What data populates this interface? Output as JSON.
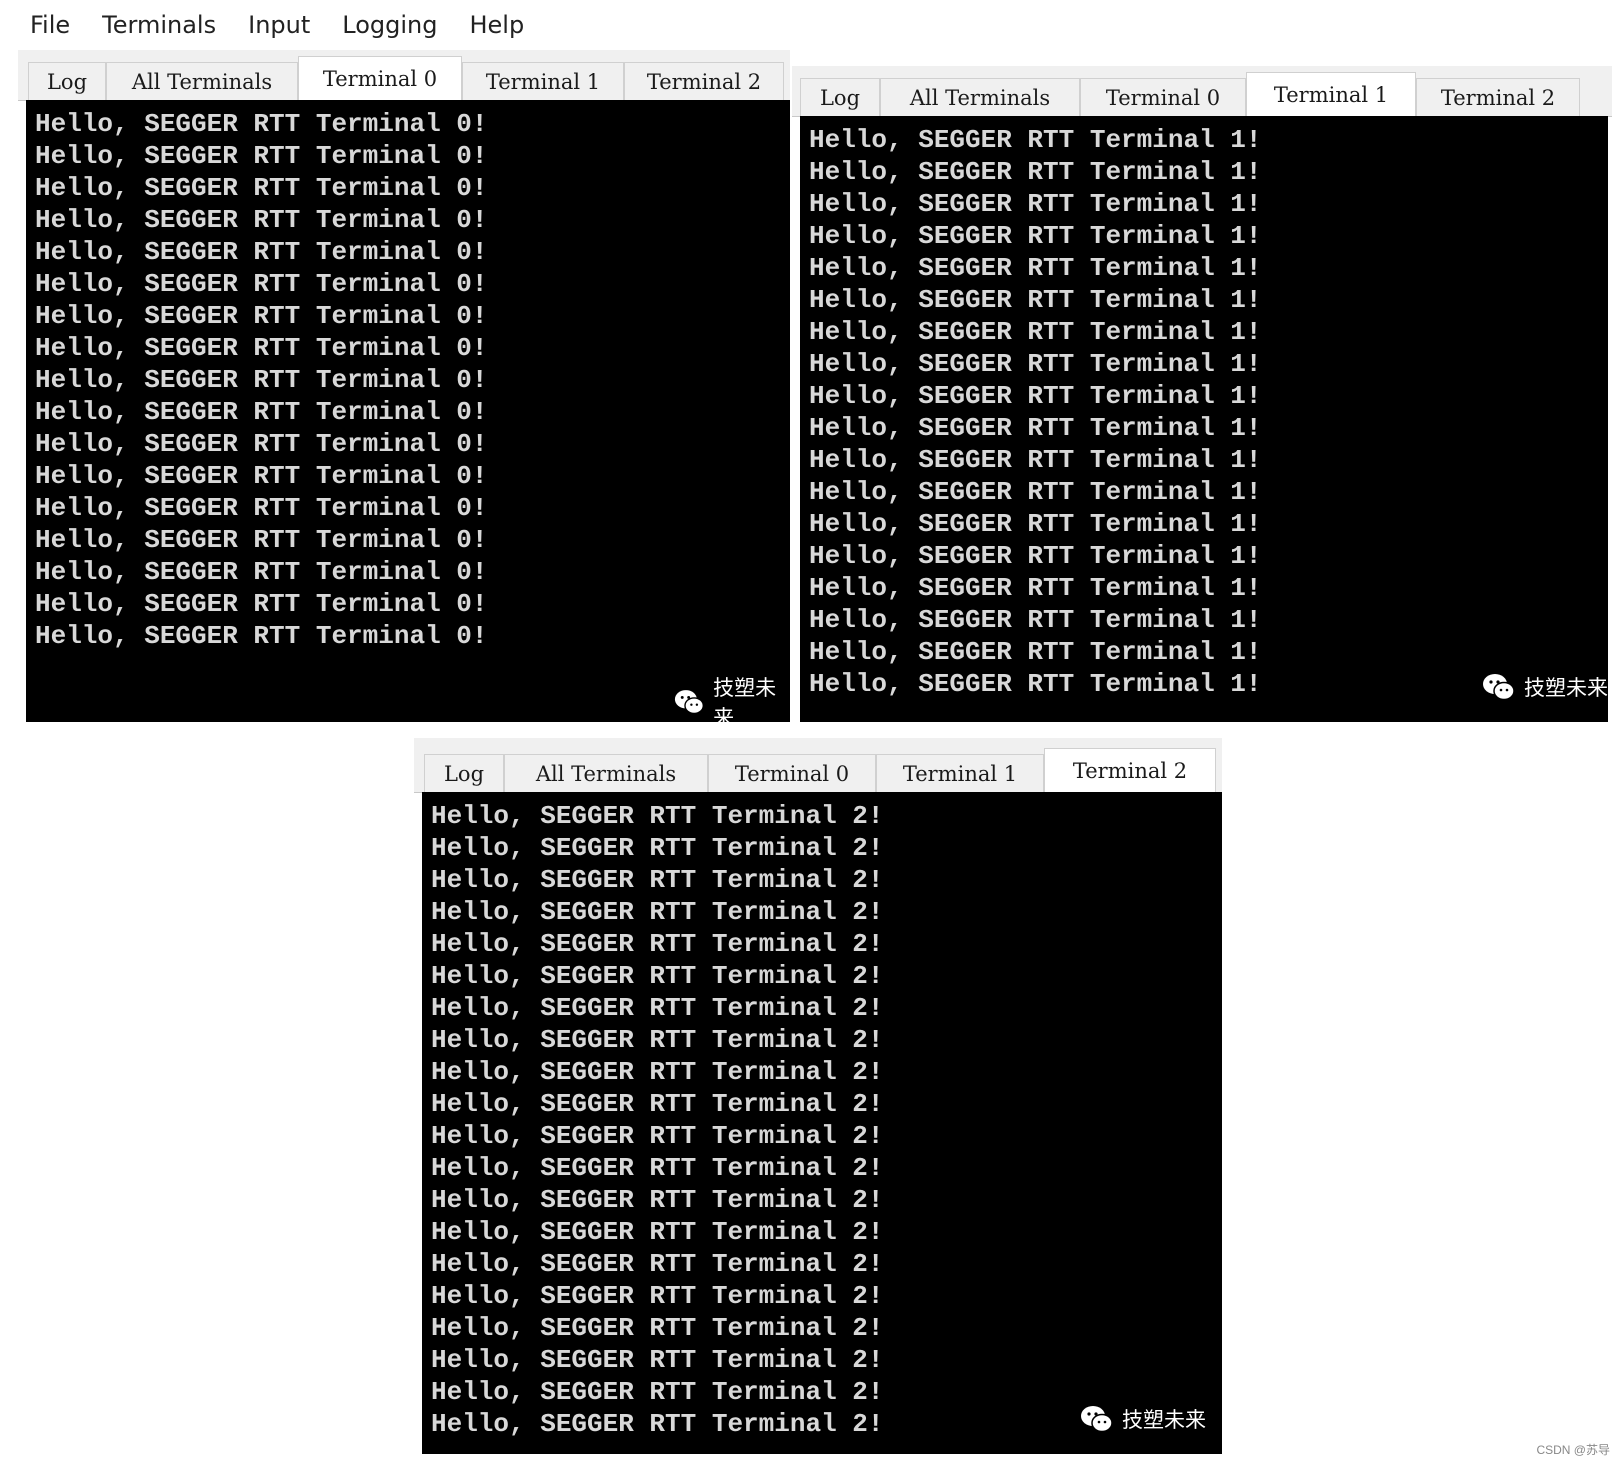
{
  "menu": {
    "file": "File",
    "terminals": "Terminals",
    "input": "Input",
    "logging": "Logging",
    "help": "Help"
  },
  "tabs": {
    "log": "Log",
    "all": "All Terminals",
    "t0": "Terminal 0",
    "t1": "Terminal 1",
    "t2": "Terminal 2"
  },
  "terminals": {
    "t0": {
      "line": "Hello, SEGGER RTT Terminal 0!",
      "visible_lines": 17
    },
    "t1": {
      "line": "Hello, SEGGER RTT Terminal 1!",
      "visible_lines": 18
    },
    "t2": {
      "line": "Hello, SEGGER RTT Terminal 2!",
      "visible_lines": 20
    }
  },
  "watermark": {
    "text": "技塑未来",
    "icon": "wechat-icon"
  },
  "credit": "CSDN @苏导",
  "colors": {
    "terminal_bg": "#000000",
    "terminal_fg": "#d8d8d8",
    "tab_bg": "#f0f0f0",
    "tab_active_bg": "#ffffff"
  }
}
